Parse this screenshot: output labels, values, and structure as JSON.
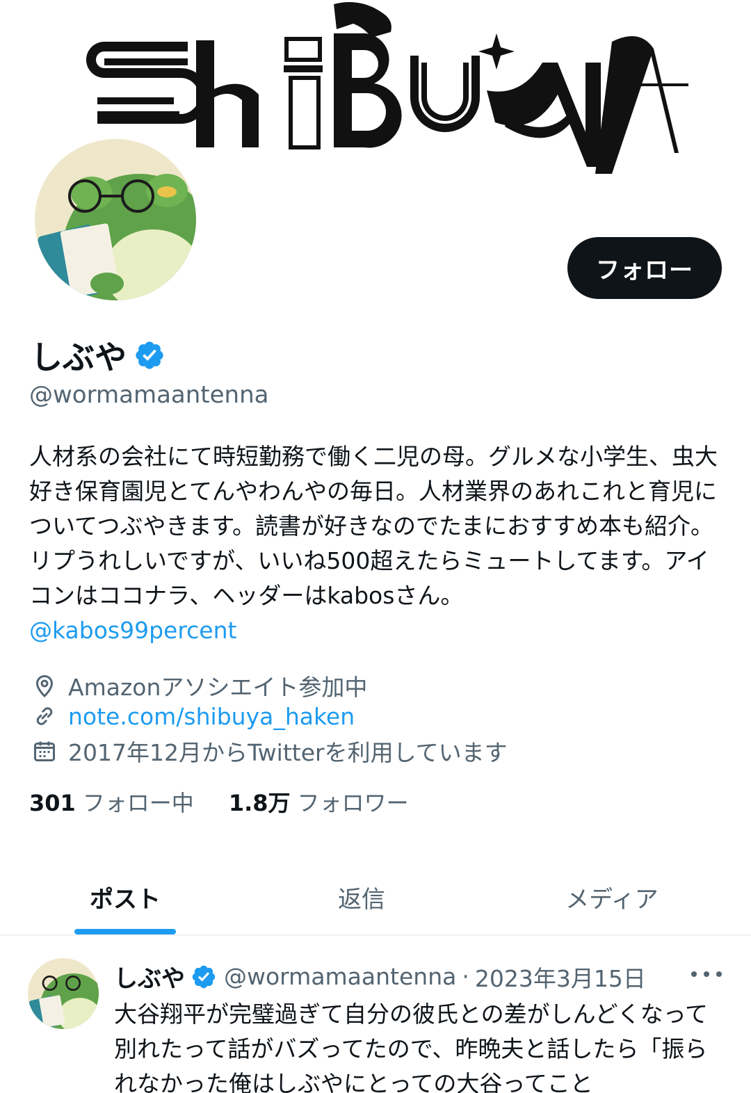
{
  "banner": {
    "logo_text": "ShiBUyA"
  },
  "profile": {
    "follow_label": "フォロー",
    "display_name": "しぶや",
    "handle": "@wormamaantenna",
    "bio": "人材系の会社にて時短勤務で働く二児の母。グルメな小学生、虫大好き保育園児とてんやわんやの毎日。人材業界のあれこれと育児についてつぶやきます。読書が好きなのでたまにおすすめ本も紹介。リプうれしいですが、いいね500超えたらミュートしてます。アイコンはココナラ、ヘッダーはkabosさん。",
    "bio_mention": "@kabos99percent",
    "location": "Amazonアソシエイト参加中",
    "url": "note.com/shibuya_haken",
    "joined": "2017年12月からTwitterを利用しています",
    "following_count": "301",
    "following_label": "フォロー中",
    "followers_count": "1.8万",
    "followers_label": "フォロワー"
  },
  "tabs": [
    {
      "label": "ポスト",
      "active": true
    },
    {
      "label": "返信",
      "active": false
    },
    {
      "label": "メディア",
      "active": false
    }
  ],
  "post": {
    "name": "しぶや",
    "handle": "@wormamaantenna",
    "separator": "·",
    "date": "2023年3月15日",
    "text": "大谷翔平が完璧過ぎて自分の彼氏との差がしんどくなって別れたって話がバズってたので、昨晩夫と話したら「振られなかった俺はしぶやにとっての大谷ってこと"
  },
  "icons": {
    "verified": "verified-badge-icon",
    "location": "location-pin-icon",
    "link": "link-icon",
    "calendar": "calendar-icon",
    "more": "more-options-icon"
  },
  "colors": {
    "accent": "#1d9bf0",
    "text": "#0f1419",
    "secondary": "#536471",
    "button_bg": "#0f1419"
  }
}
